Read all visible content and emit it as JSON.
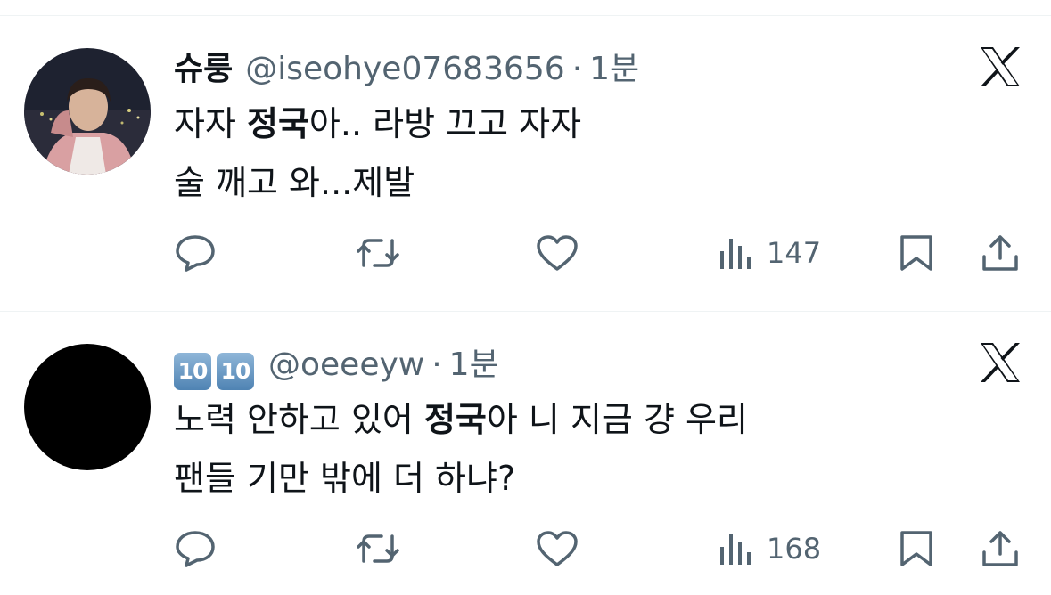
{
  "tweets": [
    {
      "display_name": "슈룽",
      "handle": "@iseohye07683656",
      "separator": "·",
      "time": "1분",
      "avatar": "avatar-photo",
      "lines": [
        {
          "pre": "자자 ",
          "bold": "정국",
          "post": "아.. 라방 끄고 자자"
        },
        {
          "pre": "술 깨고 와...제발",
          "bold": "",
          "post": ""
        }
      ],
      "views": "147",
      "icons": [
        "x-logo-icon",
        "reply-icon",
        "retweet-icon",
        "like-icon",
        "views-icon",
        "bookmark-icon",
        "share-icon"
      ]
    },
    {
      "display_name_badges": [
        "10",
        "10"
      ],
      "handle": "@oeeeyw",
      "separator": "·",
      "time": "1분",
      "avatar": "avatar-black",
      "lines": [
        {
          "pre": "노력 안하고 있어 ",
          "bold": "정국",
          "post": "아 니 지금 걍 우리"
        },
        {
          "pre": "팬들 기만 밖에 더 하냐?",
          "bold": "",
          "post": ""
        }
      ],
      "views": "168",
      "icons": [
        "x-logo-icon",
        "reply-icon",
        "retweet-icon",
        "like-icon",
        "views-icon",
        "bookmark-icon",
        "share-icon"
      ]
    }
  ],
  "colors": {
    "text": "#0f1419",
    "secondary": "#536471",
    "divider": "#eff3f4",
    "badge": "#5b8fbf"
  }
}
